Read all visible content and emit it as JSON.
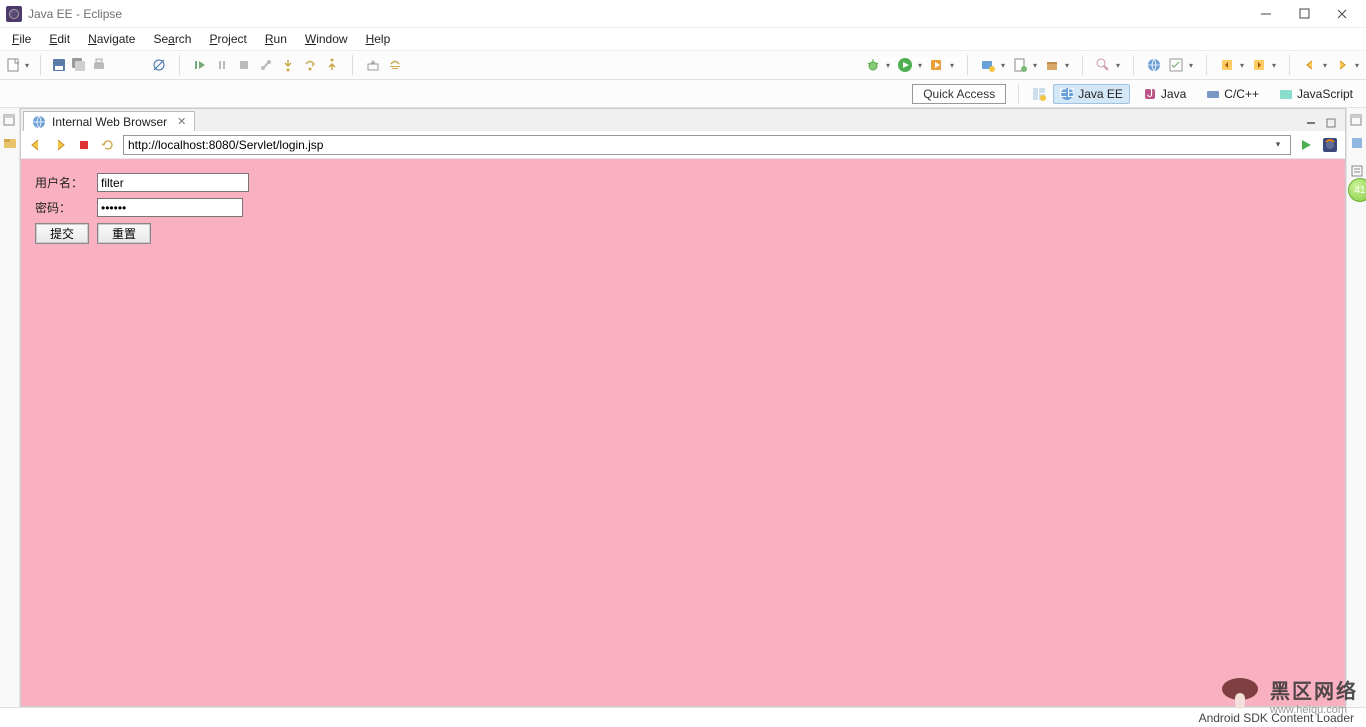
{
  "window": {
    "title": "Java EE - Eclipse"
  },
  "menu": {
    "file": "File",
    "edit": "Edit",
    "navigate": "Navigate",
    "search": "Search",
    "project": "Project",
    "run": "Run",
    "window": "Window",
    "help": "Help"
  },
  "quick_access": "Quick Access",
  "perspectives": {
    "javaee": "Java EE",
    "java": "Java",
    "cpp": "C/C++",
    "js": "JavaScript"
  },
  "tab": {
    "label": "Internal Web Browser"
  },
  "browser": {
    "url": "http://localhost:8080/Servlet/login.jsp"
  },
  "form": {
    "username_label": "用户名：",
    "password_label": "密码：",
    "username_value": "filter",
    "password_value": "••••••",
    "submit": "提交",
    "reset": "重置"
  },
  "status": {
    "right": "Android SDK Content Loader"
  },
  "float_badge": "41",
  "watermark": {
    "big": "黑区网络",
    "small": "www.heiqu.com"
  },
  "colors": {
    "page_bg": "#f9b1c1"
  }
}
